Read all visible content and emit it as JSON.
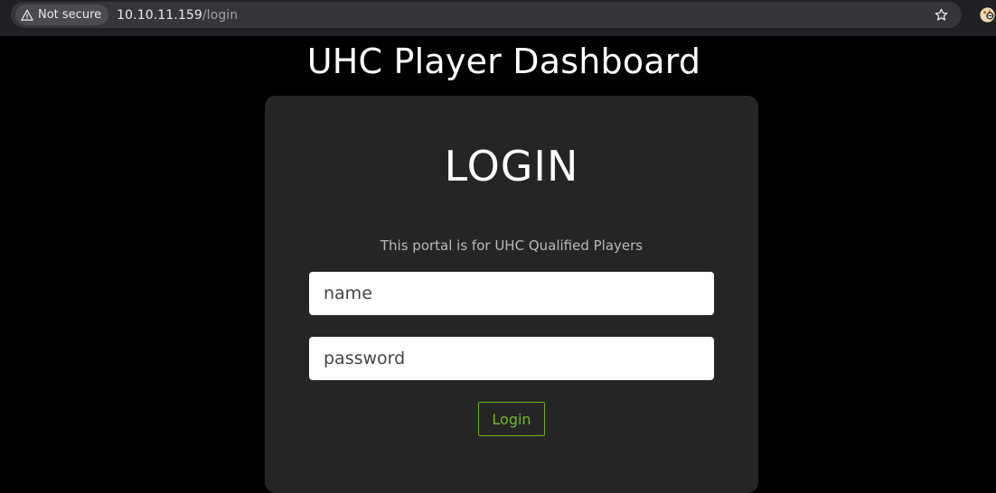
{
  "browser": {
    "security_label": "Not secure",
    "url_host": "10.10.11.159",
    "url_path": "/login",
    "icons": {
      "security": "warning-triangle-icon",
      "bookmark": "star-icon",
      "extension": "extension-icon"
    }
  },
  "page": {
    "title": "UHC Player Dashboard"
  },
  "login": {
    "heading": "LOGIN",
    "subtitle": "This portal is for UHC Qualified Players",
    "name_placeholder": "name",
    "password_placeholder": "password",
    "button_label": "Login"
  },
  "colors": {
    "background": "#000000",
    "card": "#252525",
    "accent": "#6cb221"
  }
}
